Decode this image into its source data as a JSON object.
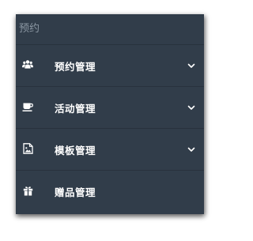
{
  "sidebar": {
    "section_label": "预约",
    "items": [
      {
        "label": "预约管理",
        "icon": "users-icon",
        "expandable": true
      },
      {
        "label": "活动管理",
        "icon": "coffee-cup-icon",
        "expandable": true
      },
      {
        "label": "模板管理",
        "icon": "image-file-icon",
        "expandable": true
      },
      {
        "label": "赠品管理",
        "icon": "gift-icon",
        "expandable": false
      }
    ]
  },
  "colors": {
    "sidebar_bg": "#313d4a",
    "section_label": "#8b97a3",
    "item_text": "#ffffff",
    "divider": "#28323d"
  }
}
